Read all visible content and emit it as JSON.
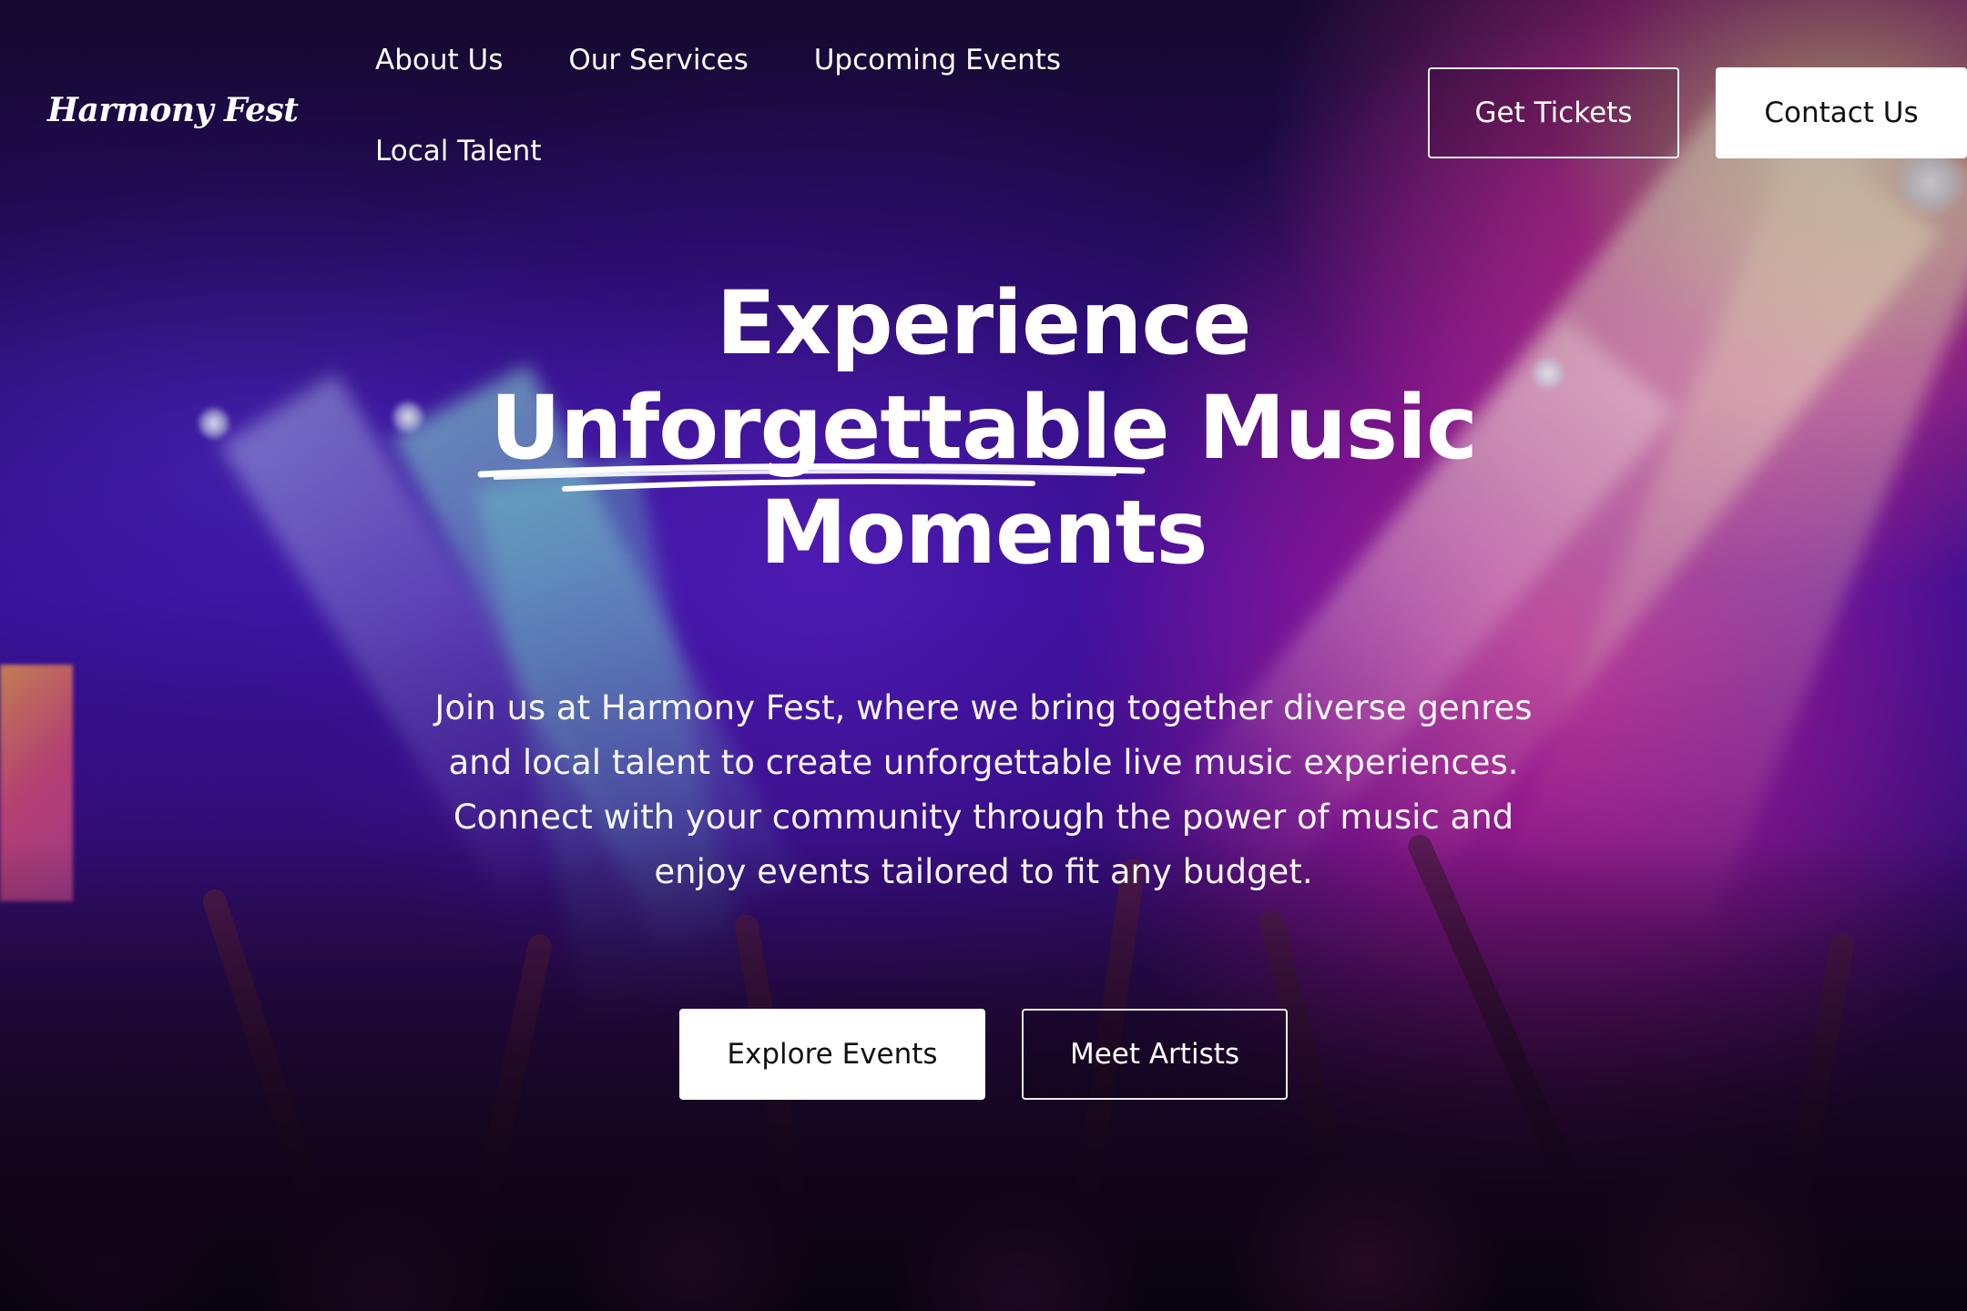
{
  "brand": {
    "logo_text": "Harmony Fest"
  },
  "nav": {
    "items": [
      {
        "label": "About Us"
      },
      {
        "label": "Our Services"
      },
      {
        "label": "Upcoming Events"
      },
      {
        "label": "Local Talent"
      }
    ]
  },
  "header_actions": {
    "tickets_label": "Get Tickets",
    "contact_label": "Contact Us"
  },
  "hero": {
    "title_line1": "Experience",
    "title_highlight": "Unforgettable",
    "title_line2_rest": "Music",
    "title_line3": "Moments",
    "subtitle": "Join us at Harmony Fest, where we bring together diverse genres and local talent to create unforgettable live music experiences. Connect with your community through the power of music and enjoy events tailored to fit any budget.",
    "primary_cta": "Explore Events",
    "secondary_cta": "Meet Artists"
  },
  "colors": {
    "text": "#ffffff",
    "button_solid_bg": "#ffffff",
    "button_solid_text": "#111111",
    "background_purple": "#3a10a0",
    "background_pink": "#e8389a"
  }
}
